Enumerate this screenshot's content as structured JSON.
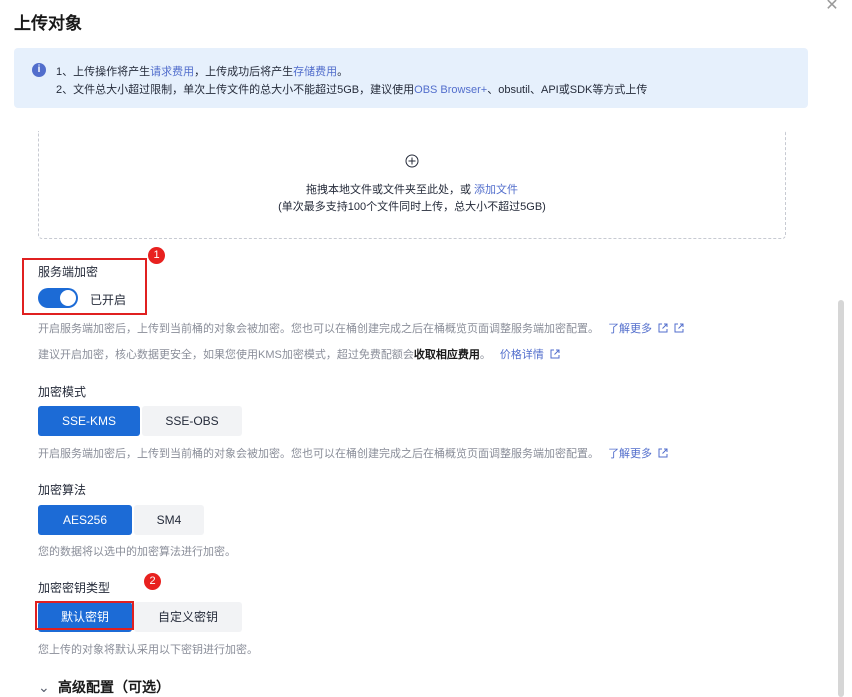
{
  "dialog": {
    "title": "上传对象"
  },
  "notice": {
    "l1_a": "1、上传操作将产生",
    "l1_link1": "请求费用",
    "l1_b": "，上传成功后将产生",
    "l1_link2": "存储费用",
    "l1_c": "。",
    "l2_a": "2、文件总大小超过限制，单次上传文件的总大小不能超过5GB，建议使用",
    "l2_link": "OBS Browser+",
    "l2_b": "、obsutil、API或SDK等方式上传"
  },
  "upload": {
    "text_a": "拖拽本地文件或文件夹至此处，或 ",
    "link": "添加文件",
    "sub": "(单次最多支持100个文件同时上传，总大小不超过5GB)"
  },
  "encryption": {
    "label": "服务端加密",
    "status": "已开启",
    "enabled": true,
    "hint1": "开启服务端加密后，上传到当前桶的对象会被加密。您也可以在桶创建完成之后在桶概览页面调整服务端加密配置。",
    "learn_more": "了解更多",
    "hint2_a": "建议开启加密，核心数据更安全，如果您使用KMS加密模式，超过免费配额会",
    "hint2_bold": "收取相应费用",
    "hint2_b": "。",
    "price_link": "价格详情"
  },
  "mode": {
    "label": "加密模式",
    "options": [
      "SSE-KMS",
      "SSE-OBS"
    ],
    "hint": "开启服务端加密后，上传到当前桶的对象会被加密。您也可以在桶创建完成之后在桶概览页面调整服务端加密配置。",
    "learn_more": "了解更多"
  },
  "algorithm": {
    "label": "加密算法",
    "options": [
      "AES256",
      "SM4"
    ],
    "hint": "您的数据将以选中的加密算法进行加密。"
  },
  "keytype": {
    "label": "加密密钥类型",
    "options": [
      "默认密钥",
      "自定义密钥"
    ],
    "hint": "您上传的对象将默认采用以下密钥进行加密。"
  },
  "advanced": {
    "label": "高级配置（可选）"
  },
  "annotations": {
    "badge1": "1",
    "badge2": "2"
  },
  "colors": {
    "primary": "#1c6bd6",
    "link": "#526ecc",
    "annotation_red": "#e02020"
  }
}
